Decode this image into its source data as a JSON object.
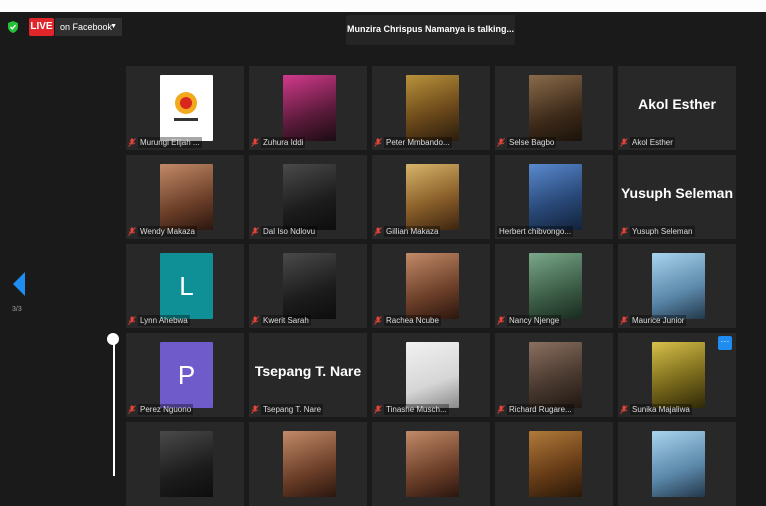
{
  "meeting": {
    "live_label": "LIVE",
    "stream_target": "on Facebook",
    "talking_banner": "Munzira Chrispus Namanya is talking...",
    "page_indicator": "3/3"
  },
  "colors": {
    "live_red": "#e0252b",
    "accent_blue": "#1e8cf0",
    "muted_red": "#e8443a",
    "tile_bg": "#282828"
  },
  "tiles": [
    {
      "name": "Murungi Elijah ...",
      "muted": true,
      "kind": "photo",
      "photo": "logo",
      "icon": "logo-image"
    },
    {
      "name": "Zuhura Iddi",
      "muted": true,
      "kind": "photo",
      "photo": "pink",
      "icon": "participant-photo"
    },
    {
      "name": "Peter Mmbando...",
      "muted": true,
      "kind": "photo",
      "photo": "gold",
      "icon": "participant-photo"
    },
    {
      "name": "Selse Bagbo",
      "muted": true,
      "kind": "photo",
      "photo": "tan",
      "icon": "participant-photo"
    },
    {
      "name": "Akol Esther",
      "muted": true,
      "kind": "name",
      "display": "Akol Esther"
    },
    {
      "name": "Wendy Makaza",
      "muted": true,
      "kind": "photo",
      "photo": "warm",
      "icon": "participant-photo"
    },
    {
      "name": "Dal Iso Ndlovu",
      "muted": true,
      "kind": "photo",
      "photo": "dark",
      "icon": "participant-photo"
    },
    {
      "name": "Gillian Makaza",
      "muted": true,
      "kind": "photo",
      "photo": "blonde",
      "icon": "participant-photo"
    },
    {
      "name": "Herbert chibvongo...",
      "muted": false,
      "kind": "photo",
      "photo": "blue",
      "icon": "participant-photo"
    },
    {
      "name": "Yusuph Seleman",
      "muted": true,
      "kind": "name",
      "display": "Yusuph Seleman"
    },
    {
      "name": "Lynn Ahebwa",
      "muted": true,
      "kind": "initial",
      "display": "L",
      "color": "#0f8f96"
    },
    {
      "name": "Kwerit Sarah",
      "muted": true,
      "kind": "photo",
      "photo": "dark",
      "icon": "participant-photo"
    },
    {
      "name": "Rachea Ncube",
      "muted": true,
      "kind": "photo",
      "photo": "warm",
      "icon": "participant-photo"
    },
    {
      "name": "Nancy Njenge",
      "muted": true,
      "kind": "photo",
      "photo": "green",
      "icon": "participant-photo"
    },
    {
      "name": "Maurice Junior",
      "muted": true,
      "kind": "photo",
      "photo": "sky",
      "icon": "participant-photo"
    },
    {
      "name": "Perez Nguono",
      "muted": true,
      "kind": "initial",
      "display": "P",
      "color": "#6f5bc9"
    },
    {
      "name": "Tsepang T. Nare",
      "muted": true,
      "kind": "name",
      "display": "Tsepang T. Nare"
    },
    {
      "name": "Tinashe Musch...",
      "muted": true,
      "kind": "photo",
      "photo": "white",
      "icon": "participant-photo"
    },
    {
      "name": "Richard Rugare...",
      "muted": true,
      "kind": "photo",
      "photo": "room",
      "icon": "participant-photo"
    },
    {
      "name": "Sunika Majaliwa",
      "muted": true,
      "kind": "photo",
      "photo": "yellow",
      "icon": "participant-photo"
    },
    {
      "name": "",
      "muted": false,
      "kind": "photo",
      "photo": "dark",
      "icon": "participant-photo"
    },
    {
      "name": "",
      "muted": false,
      "kind": "photo",
      "photo": "warm",
      "icon": "participant-photo"
    },
    {
      "name": "",
      "muted": false,
      "kind": "photo",
      "photo": "warm",
      "icon": "participant-photo"
    },
    {
      "name": "",
      "muted": false,
      "kind": "photo",
      "photo": "shelf",
      "icon": "participant-photo"
    },
    {
      "name": "",
      "muted": false,
      "kind": "photo",
      "photo": "sky",
      "icon": "participant-photo"
    }
  ]
}
